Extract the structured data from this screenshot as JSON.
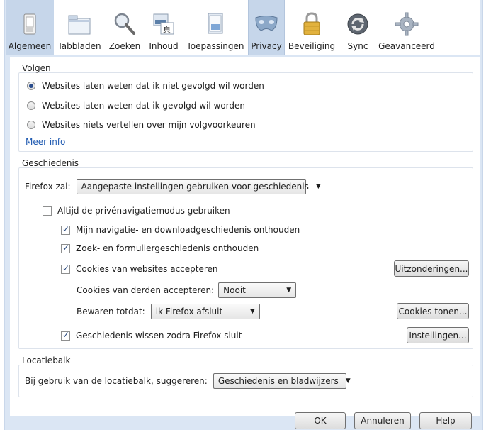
{
  "toolbar": {
    "tabs": [
      {
        "label": "Algemeen",
        "icon": "general-switch-icon"
      },
      {
        "label": "Tabbladen",
        "icon": "tabs-icon"
      },
      {
        "label": "Zoeken",
        "icon": "search-icon"
      },
      {
        "label": "Inhoud",
        "icon": "content-icon"
      },
      {
        "label": "Toepassingen",
        "icon": "applications-icon"
      },
      {
        "label": "Privacy",
        "icon": "privacy-mask-icon"
      },
      {
        "label": "Beveiliging",
        "icon": "security-lock-icon"
      },
      {
        "label": "Sync",
        "icon": "sync-icon"
      },
      {
        "label": "Geavanceerd",
        "icon": "gear-icon"
      }
    ],
    "active": "Privacy"
  },
  "tracking": {
    "title": "Volgen",
    "options": [
      {
        "label": "Websites laten weten dat ik niet gevolgd wil worden",
        "selected": true
      },
      {
        "label": "Websites laten weten dat ik gevolgd wil worden",
        "selected": false
      },
      {
        "label": "Websites niets vertellen over mijn volgvoorkeuren",
        "selected": false
      }
    ],
    "more_info": "Meer info"
  },
  "history": {
    "title": "Geschiedenis",
    "firefox_will_label": "Firefox zal:",
    "firefox_will_value": "Aangepaste instellingen gebruiken voor geschiedenis",
    "private_mode_label": "Altijd de privénavigatiemodus gebruiken",
    "remember_browsing_label": "Mijn navigatie- en downloadgeschiedenis onthouden",
    "remember_search_label": "Zoek- en formuliergeschiedenis onthouden",
    "accept_cookies_label": "Cookies van websites accepteren",
    "exceptions_button": "Uitzonderingen...",
    "third_party_label": "Cookies van derden accepteren:",
    "third_party_value": "Nooit",
    "keep_until_label": "Bewaren totdat:",
    "keep_until_value": "ik Firefox afsluit",
    "show_cookies_button": "Cookies tonen...",
    "clear_on_close_label": "Geschiedenis wissen zodra Firefox sluit",
    "settings_button": "Instellingen..."
  },
  "locationbar": {
    "title": "Locatiebalk",
    "suggest_label": "Bij gebruik van de locatiebalk, suggereren:",
    "suggest_value": "Geschiedenis en bladwijzers"
  },
  "footer": {
    "ok": "OK",
    "cancel": "Annuleren",
    "help": "Help"
  },
  "colors": {
    "frame": "#dbe6f4",
    "active_tab": "#c6d6ea",
    "link": "#1f5ab1"
  }
}
